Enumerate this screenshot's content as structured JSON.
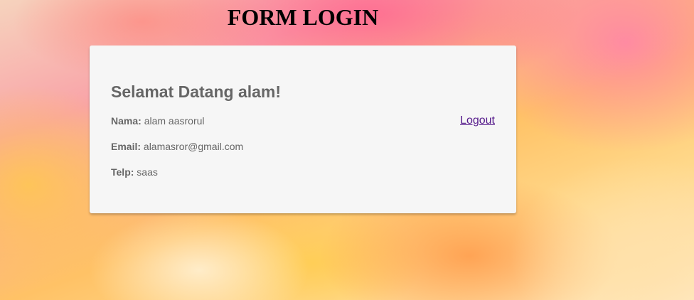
{
  "page": {
    "title": "FORM LOGIN"
  },
  "card": {
    "welcome": "Selamat Datang alam!",
    "logout_label": "Logout",
    "fields": [
      {
        "label": "Nama:",
        "value": "alam aasrorul"
      },
      {
        "label": "Email:",
        "value": "alamasror@gmail.com"
      },
      {
        "label": "Telp:",
        "value": "saas"
      }
    ]
  },
  "colors": {
    "card_bg": "#f6f6f6",
    "text_gray": "#666666",
    "link_visited": "#551a8b"
  }
}
